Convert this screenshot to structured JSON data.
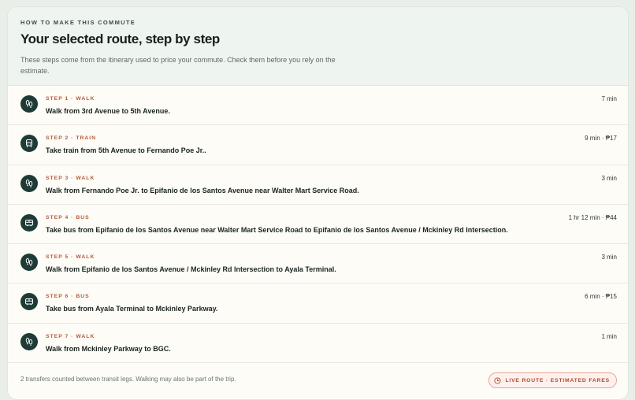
{
  "header": {
    "eyebrow": "HOW TO MAKE THIS COMMUTE",
    "title": "Your selected route, step by step",
    "description": "These steps come from the itinerary used to price your commute. Check them before you rely on the estimate."
  },
  "steps": [
    {
      "kicker": "STEP 1 · WALK",
      "icon": "walk-icon",
      "text": "Walk from 3rd Avenue to 5th Avenue.",
      "meta": "7 min"
    },
    {
      "kicker": "STEP 2 · TRAIN",
      "icon": "train-icon",
      "text": "Take train from 5th Avenue to Fernando Poe Jr..",
      "meta": "9 min · ₱17"
    },
    {
      "kicker": "STEP 3 · WALK",
      "icon": "walk-icon",
      "text": "Walk from Fernando Poe Jr. to Epifanio de los Santos Avenue near Walter Mart Service Road.",
      "meta": "3 min"
    },
    {
      "kicker": "STEP 4 · BUS",
      "icon": "bus-icon",
      "text": "Take bus from Epifanio de los Santos Avenue near Walter Mart Service Road to Epifanio de los Santos Avenue / Mckinley Rd Intersection.",
      "meta": "1 hr 12 min · ₱44"
    },
    {
      "kicker": "STEP 5 · WALK",
      "icon": "walk-icon",
      "text": "Walk from Epifanio de los Santos Avenue / Mckinley Rd Intersection to Ayala Terminal.",
      "meta": "3 min"
    },
    {
      "kicker": "STEP 6 · BUS",
      "icon": "bus-icon",
      "text": "Take bus from Ayala Terminal to Mckinley Parkway.",
      "meta": "6 min · ₱15"
    },
    {
      "kicker": "STEP 7 · WALK",
      "icon": "walk-icon",
      "text": "Walk from Mckinley Parkway to BGC.",
      "meta": "1 min"
    }
  ],
  "footer": {
    "note": "2 transfers counted between transit legs. Walking may also be part of the trip.",
    "badge_label": "LIVE ROUTE · ESTIMATED FARES",
    "badge_icon": "clock-icon"
  },
  "colors": {
    "accent": "#b65a38",
    "icon_bg": "#1e3b36",
    "badge_text": "#b6452f"
  }
}
